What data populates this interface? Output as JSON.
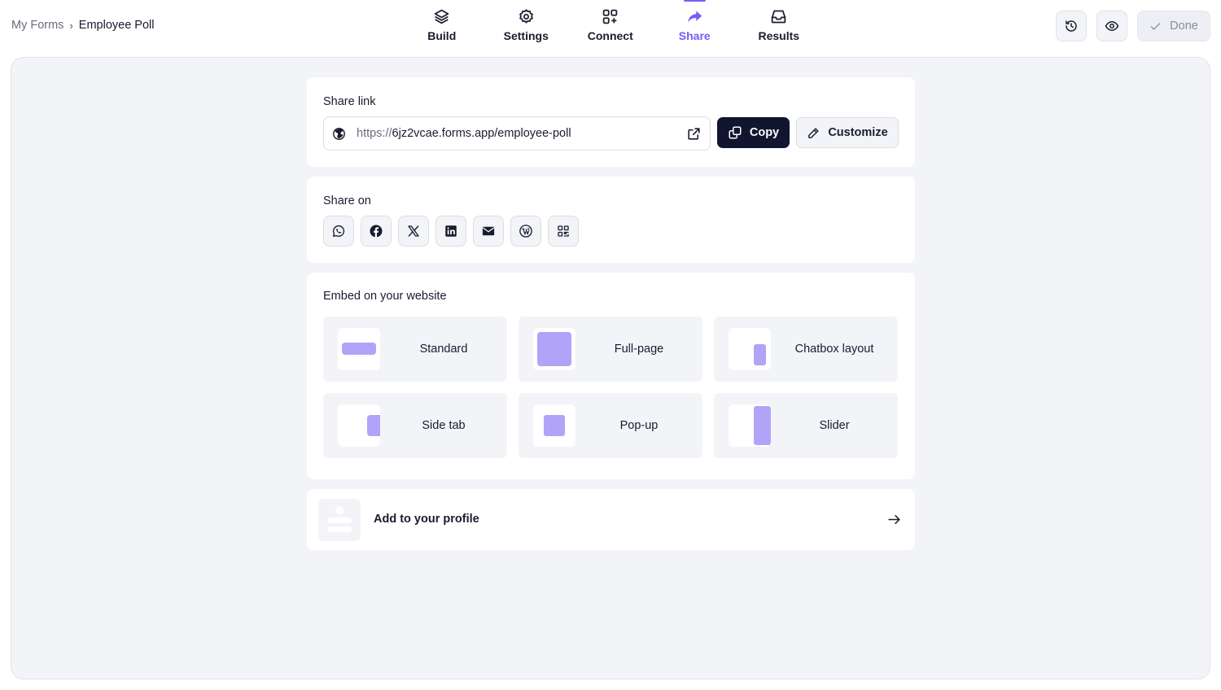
{
  "breadcrumb": {
    "root": "My Forms",
    "separator": "›",
    "current": "Employee Poll"
  },
  "nav": {
    "tabs": [
      {
        "label": "Build",
        "icon": "layers-icon"
      },
      {
        "label": "Settings",
        "icon": "gear-icon"
      },
      {
        "label": "Connect",
        "icon": "apps-plus-icon"
      },
      {
        "label": "Share",
        "icon": "share-arrow-icon",
        "active": true
      },
      {
        "label": "Results",
        "icon": "inbox-icon"
      }
    ]
  },
  "actions": {
    "done_label": "Done",
    "history_icon": "history-icon",
    "preview_icon": "eye-icon"
  },
  "share_link": {
    "title": "Share link",
    "url_protocol": "https://",
    "url_rest": "6jz2vcae.forms.app/employee-poll",
    "copy_label": "Copy",
    "customize_label": "Customize"
  },
  "share_on": {
    "title": "Share on",
    "networks": [
      "whatsapp-icon",
      "facebook-icon",
      "x-icon",
      "linkedin-icon",
      "email-icon",
      "wordpress-icon",
      "qr-code-icon"
    ]
  },
  "embed": {
    "title": "Embed on your website",
    "options": [
      {
        "label": "Standard"
      },
      {
        "label": "Full-page"
      },
      {
        "label": "Chatbox layout"
      },
      {
        "label": "Side tab"
      },
      {
        "label": "Pop-up"
      },
      {
        "label": "Slider"
      }
    ]
  },
  "profile": {
    "label": "Add to your profile"
  },
  "colors": {
    "accent": "#7a5af8",
    "thumb": "#b1a4f8",
    "dark_button": "#111530",
    "panel_bg": "#f3f4f8"
  }
}
